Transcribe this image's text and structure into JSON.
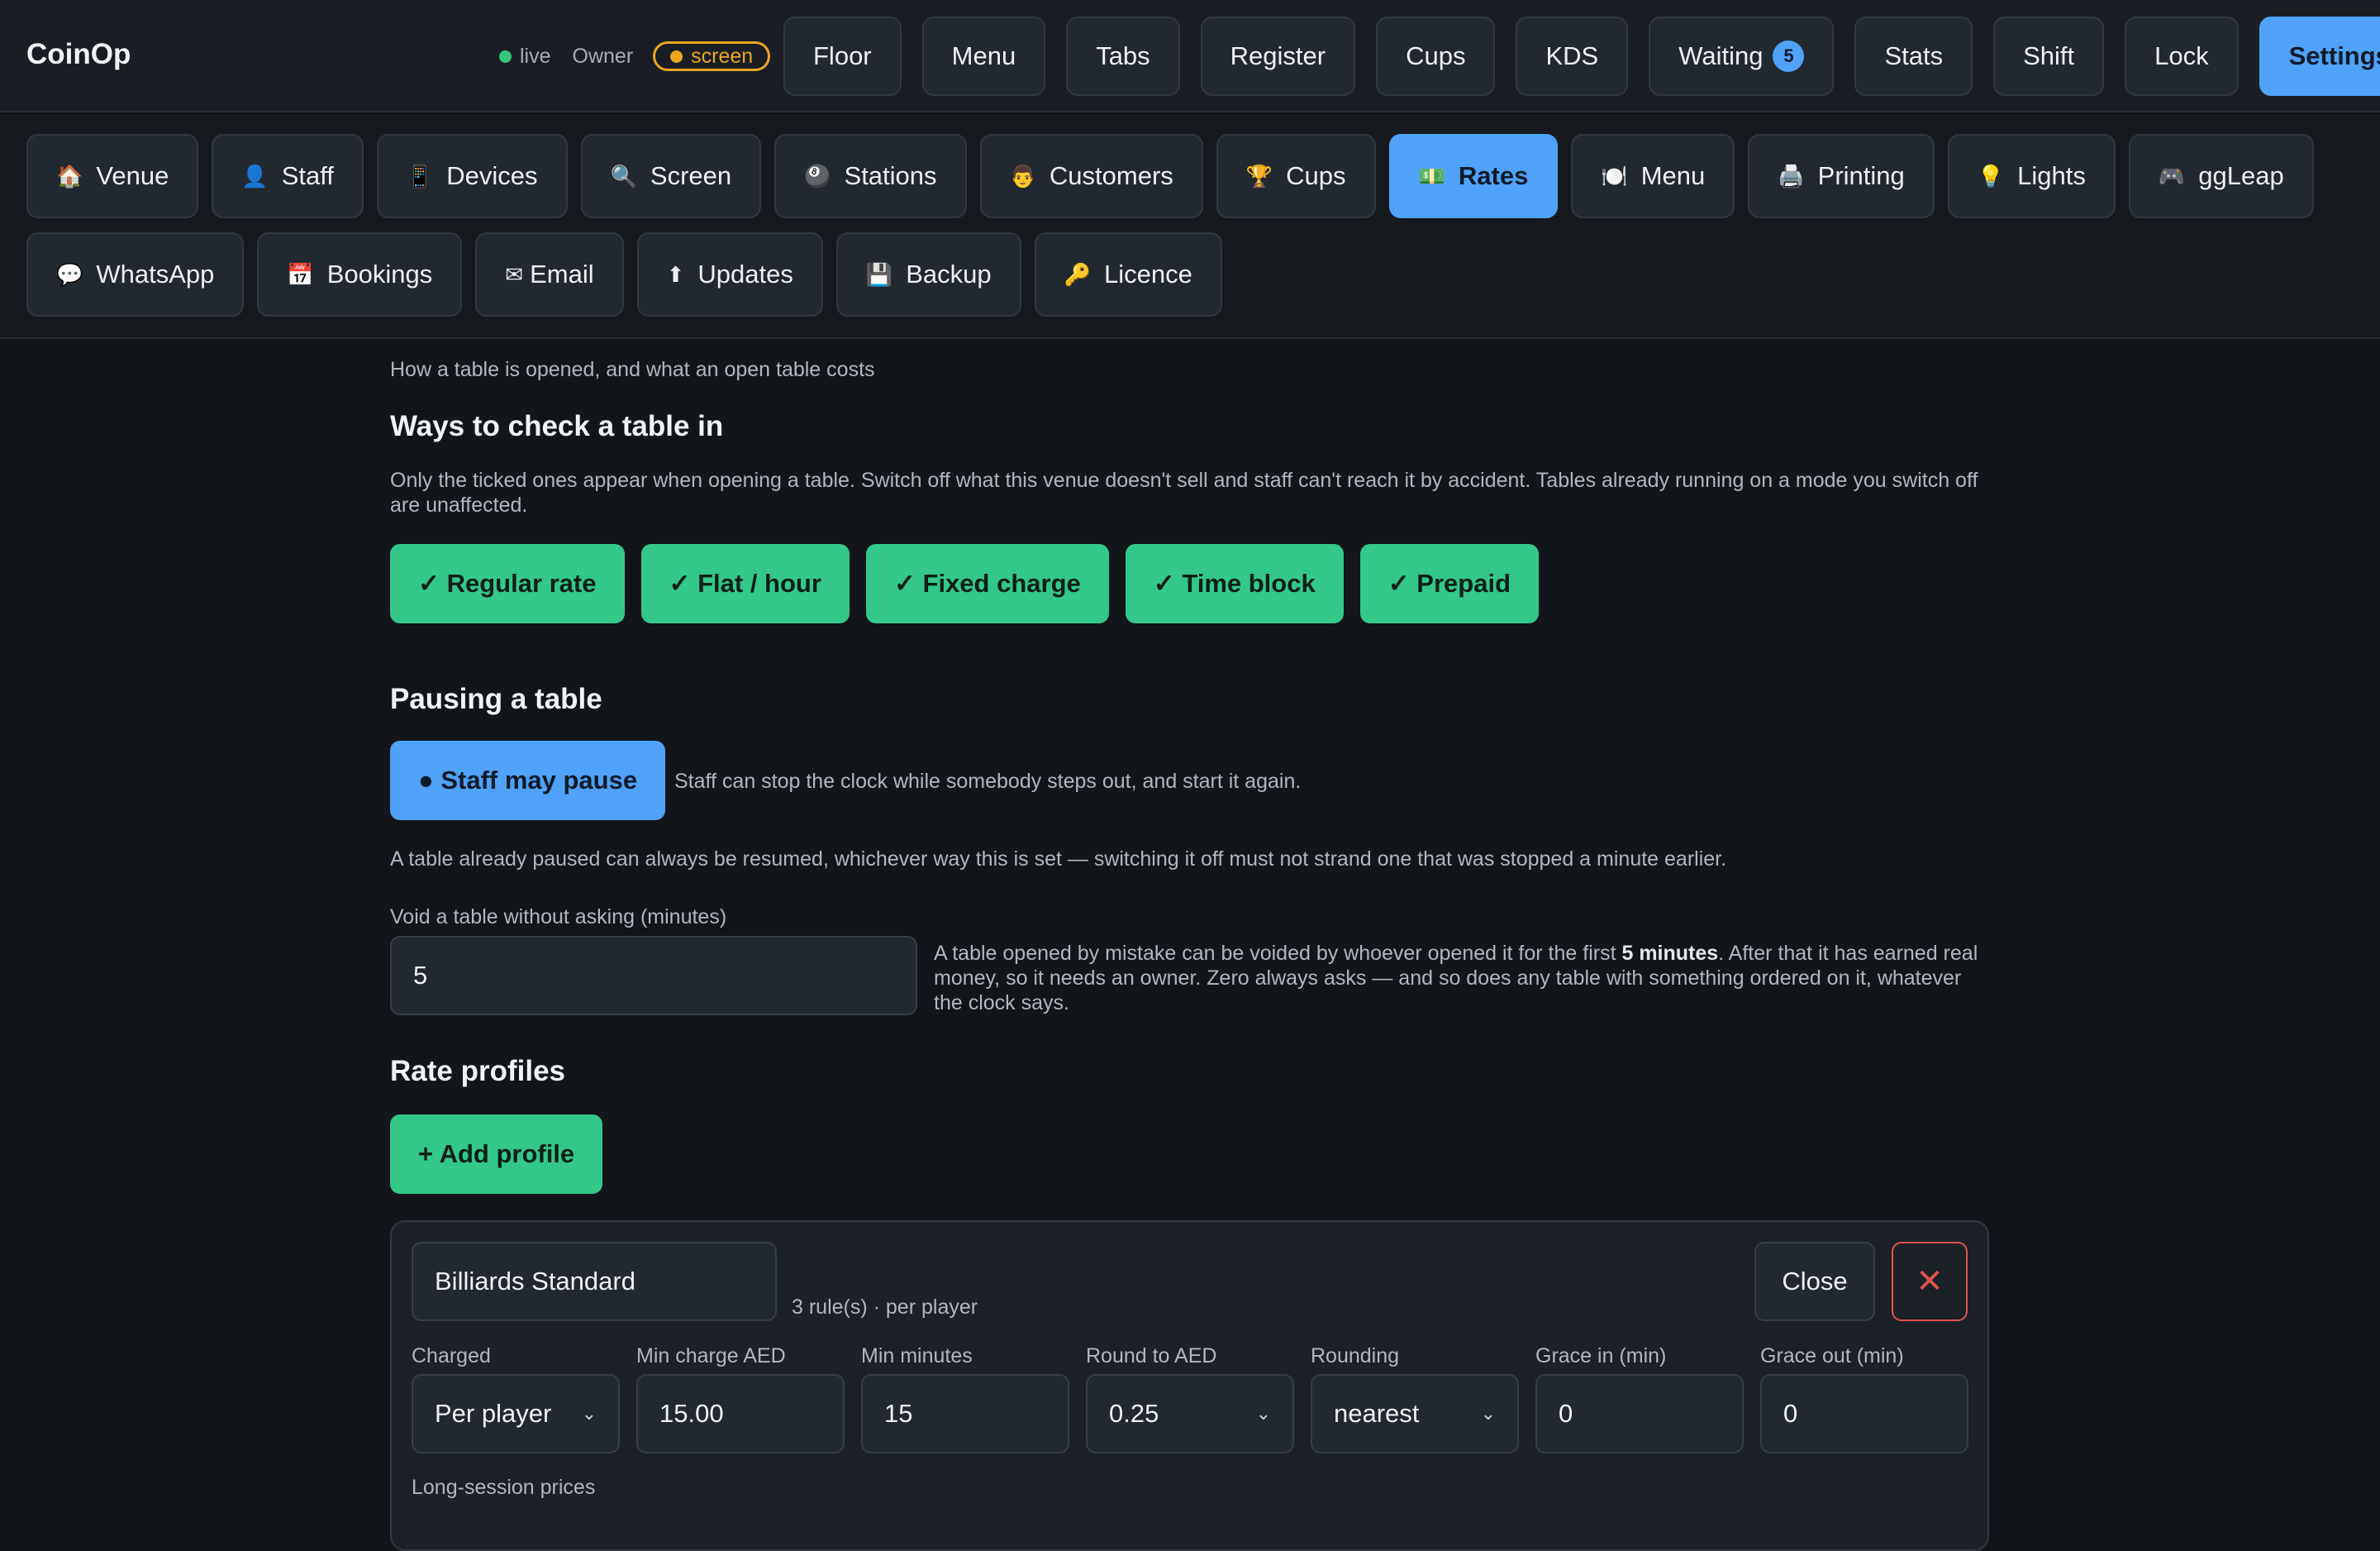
{
  "app": {
    "title": "CoinOp",
    "status_live": "live",
    "role": "Owner",
    "mode_badge": "screen"
  },
  "nav": {
    "items": [
      {
        "label": "Floor"
      },
      {
        "label": "Menu"
      },
      {
        "label": "Tabs"
      },
      {
        "label": "Register"
      },
      {
        "label": "Cups"
      },
      {
        "label": "KDS"
      },
      {
        "label": "Waiting",
        "badge": "5"
      },
      {
        "label": "Stats"
      },
      {
        "label": "Shift"
      },
      {
        "label": "Lock"
      },
      {
        "label": "Settings",
        "active": true
      }
    ]
  },
  "settings_sections": {
    "row1": [
      {
        "icon": "🏠",
        "label": "Venue"
      },
      {
        "icon": "👤",
        "label": "Staff"
      },
      {
        "icon": "📱",
        "label": "Devices"
      },
      {
        "icon": "🔍",
        "label": "Screen"
      },
      {
        "icon": "🎱",
        "label": "Stations"
      },
      {
        "icon": "👨",
        "label": "Customers"
      },
      {
        "icon": "🏆",
        "label": "Cups"
      },
      {
        "icon": "💵",
        "label": "Rates",
        "active": true
      },
      {
        "icon": "🍽️",
        "label": "Menu"
      },
      {
        "icon": "🖨️",
        "label": "Printing"
      },
      {
        "icon": "💡",
        "label": "Lights"
      },
      {
        "icon": "🎮",
        "label": "ggLeap"
      }
    ],
    "row2": [
      {
        "icon": "💬",
        "label": "WhatsApp"
      },
      {
        "icon": "📅",
        "label": "Bookings"
      },
      {
        "icon": "✉",
        "label": "Email"
      },
      {
        "icon": "⬆",
        "label": "Updates"
      },
      {
        "icon": "💾",
        "label": "Backup"
      },
      {
        "icon": "🔑",
        "label": "Licence"
      }
    ]
  },
  "rates": {
    "intro": "How a table is opened, and what an open table costs",
    "checkin_heading": "Ways to check a table in",
    "checkin_desc": "Only the ticked ones appear when opening a table. Switch off what this venue doesn't sell and staff can't reach it by accident. Tables already running on a mode you switch off are unaffected.",
    "modes": [
      "✓ Regular rate",
      "✓ Flat / hour",
      "✓ Fixed charge",
      "✓ Time block",
      "✓ Prepaid"
    ],
    "pause_heading": "Pausing a table",
    "pause_toggle": "● Staff may pause",
    "pause_desc": "Staff can stop the clock while somebody steps out, and start it again.",
    "pause_note": "A table already paused can always be resumed, whichever way this is set — switching it off must not strand one that was stopped a minute earlier.",
    "void_label": "Void a table without asking (minutes)",
    "void_value": "5",
    "void_help_1": "A table opened by mistake can be voided by whoever opened it for the first ",
    "void_help_bold": "5 minutes",
    "void_help_2": ". After that it has earned real money, so it needs an owner. Zero always asks — and so does any table with something ordered on it, whatever the clock says.",
    "profiles_heading": "Rate profiles",
    "add_profile": "+ Add profile",
    "profile": {
      "name": "Billiards Standard",
      "summary": "3 rule(s) · per player",
      "close_label": "Close",
      "delete_symbol": "✕",
      "fields": [
        {
          "label": "Charged",
          "value": "Per player",
          "select": true
        },
        {
          "label": "Min charge AED",
          "value": "15.00"
        },
        {
          "label": "Min minutes",
          "value": "15"
        },
        {
          "label": "Round to AED",
          "value": "0.25",
          "select": true
        },
        {
          "label": "Rounding",
          "value": "nearest",
          "select": true
        },
        {
          "label": "Grace in (min)",
          "value": "0"
        },
        {
          "label": "Grace out (min)",
          "value": "0"
        }
      ],
      "long_session_label": "Long-session prices"
    }
  }
}
